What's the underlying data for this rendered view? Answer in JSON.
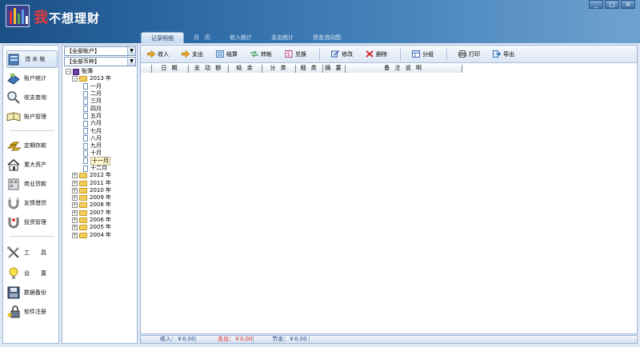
{
  "app": {
    "title_prefix": "我",
    "title_rest": "不想理财",
    "window_buttons": [
      "_",
      "□",
      "×"
    ]
  },
  "tabs": [
    {
      "label": "记录明细",
      "active": true
    },
    {
      "label": "月　历",
      "active": false
    },
    {
      "label": "收入统计",
      "active": false
    },
    {
      "label": "支出统计",
      "active": false
    },
    {
      "label": "资金流向图",
      "active": false
    }
  ],
  "leftnav": [
    {
      "label": "流 水 帐",
      "icon": "ledger-icon",
      "active": true
    },
    {
      "label": "账户统计",
      "icon": "account-stats-icon"
    },
    {
      "label": "收支查询",
      "icon": "search-icon"
    },
    {
      "label": "账户管理",
      "icon": "book-icon"
    },
    {
      "label": "定期存款",
      "icon": "gold-bars-icon"
    },
    {
      "label": "重大资产",
      "icon": "house-icon"
    },
    {
      "label": "商业贷款",
      "icon": "commercial-loan-icon"
    },
    {
      "label": "友情借贷",
      "icon": "magnet-icon"
    },
    {
      "label": "投资管理",
      "icon": "investment-icon"
    },
    {
      "label": "工　　具",
      "icon": "tools-icon"
    },
    {
      "label": "设　　置",
      "icon": "lightbulb-icon"
    },
    {
      "label": "数据备份",
      "icon": "floppy-disk-icon"
    },
    {
      "label": "软件注册",
      "icon": "key-lock-icon"
    }
  ],
  "account_panel": {
    "account_combo": "【全部帐户】",
    "currency_combo": "【全部币种】",
    "tree_root": "账簿",
    "expanded_year": "2013 年",
    "months": [
      "一月",
      "二月",
      "三月",
      "四月",
      "五月",
      "六月",
      "七月",
      "八月",
      "九月",
      "十月",
      "十一月",
      "十二月"
    ],
    "selected_month": "十一月",
    "other_years": [
      "2012 年",
      "2011 年",
      "2010 年",
      "2009 年",
      "2008 年",
      "2007 年",
      "2006 年",
      "2005 年",
      "2004 年"
    ]
  },
  "toolbar": [
    {
      "label": "收入",
      "icon": "income-arrow-icon",
      "color": "#e7a21f"
    },
    {
      "label": "支出",
      "icon": "expense-arrow-icon",
      "color": "#e7a21f"
    },
    {
      "label": "结算",
      "icon": "settle-icon",
      "color": "#4a7fc0"
    },
    {
      "label": "转帐",
      "icon": "transfer-icon",
      "color": "#2f9a4a"
    },
    {
      "label": "兑换",
      "icon": "exchange-icon",
      "color": "#b03a8a"
    },
    {
      "label": "修改",
      "icon": "edit-icon",
      "color": "#3a66b0"
    },
    {
      "label": "删除",
      "icon": "delete-icon",
      "color": "#d22b2b"
    },
    {
      "label": "分组",
      "icon": "group-icon",
      "color": "#3a66b0"
    },
    {
      "label": "打印",
      "icon": "print-icon",
      "color": "#555555"
    },
    {
      "label": "导出",
      "icon": "export-icon",
      "color": "#2f6fb8"
    }
  ],
  "grid_columns": [
    "日 期",
    "支 动 额",
    "结 余",
    "分 类",
    "细 类",
    "摘 要",
    "备 注 说 明"
  ],
  "status": {
    "income": "收入：￥0.00",
    "expense": "支出：￥0.00",
    "balance": "节余：￥0.00"
  },
  "colors": {
    "header_dark": "#1a4f86",
    "panel_border": "#9db7d6",
    "expense_text": "#d22b2b",
    "income_text": "#1c3f8a"
  }
}
